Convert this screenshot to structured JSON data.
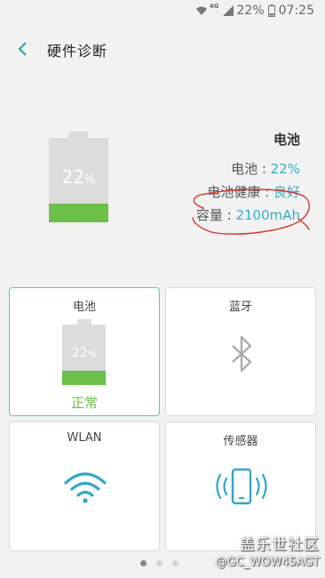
{
  "status_bar": {
    "network": "4G",
    "battery": "22%",
    "time": "07:25"
  },
  "header": {
    "title": "硬件诊断"
  },
  "summary": {
    "battery_percent": "22",
    "percent_sign": "%",
    "battery_level": 0.22,
    "title": "电池",
    "rows": [
      {
        "label": "电池 : ",
        "value": "22%"
      },
      {
        "label": "电池健康 : ",
        "value": "良好"
      },
      {
        "label": "容量 : ",
        "value": "2100mAh"
      }
    ]
  },
  "cards": {
    "battery": {
      "label": "电池",
      "percent": "22",
      "percent_sign": "%",
      "status": "正常"
    },
    "bluetooth": {
      "label": "蓝牙"
    },
    "wlan": {
      "label": "WLAN"
    },
    "sensor": {
      "label": "传感器"
    }
  },
  "pager": {
    "count": 3,
    "active": 0
  },
  "watermark": {
    "line1": "盖乐世社区",
    "line2": "@GC_WOW45AGT"
  },
  "colors": {
    "accent": "#34b0c7",
    "battery_fill": "#6cc04a",
    "annotation": "#d9332b"
  }
}
